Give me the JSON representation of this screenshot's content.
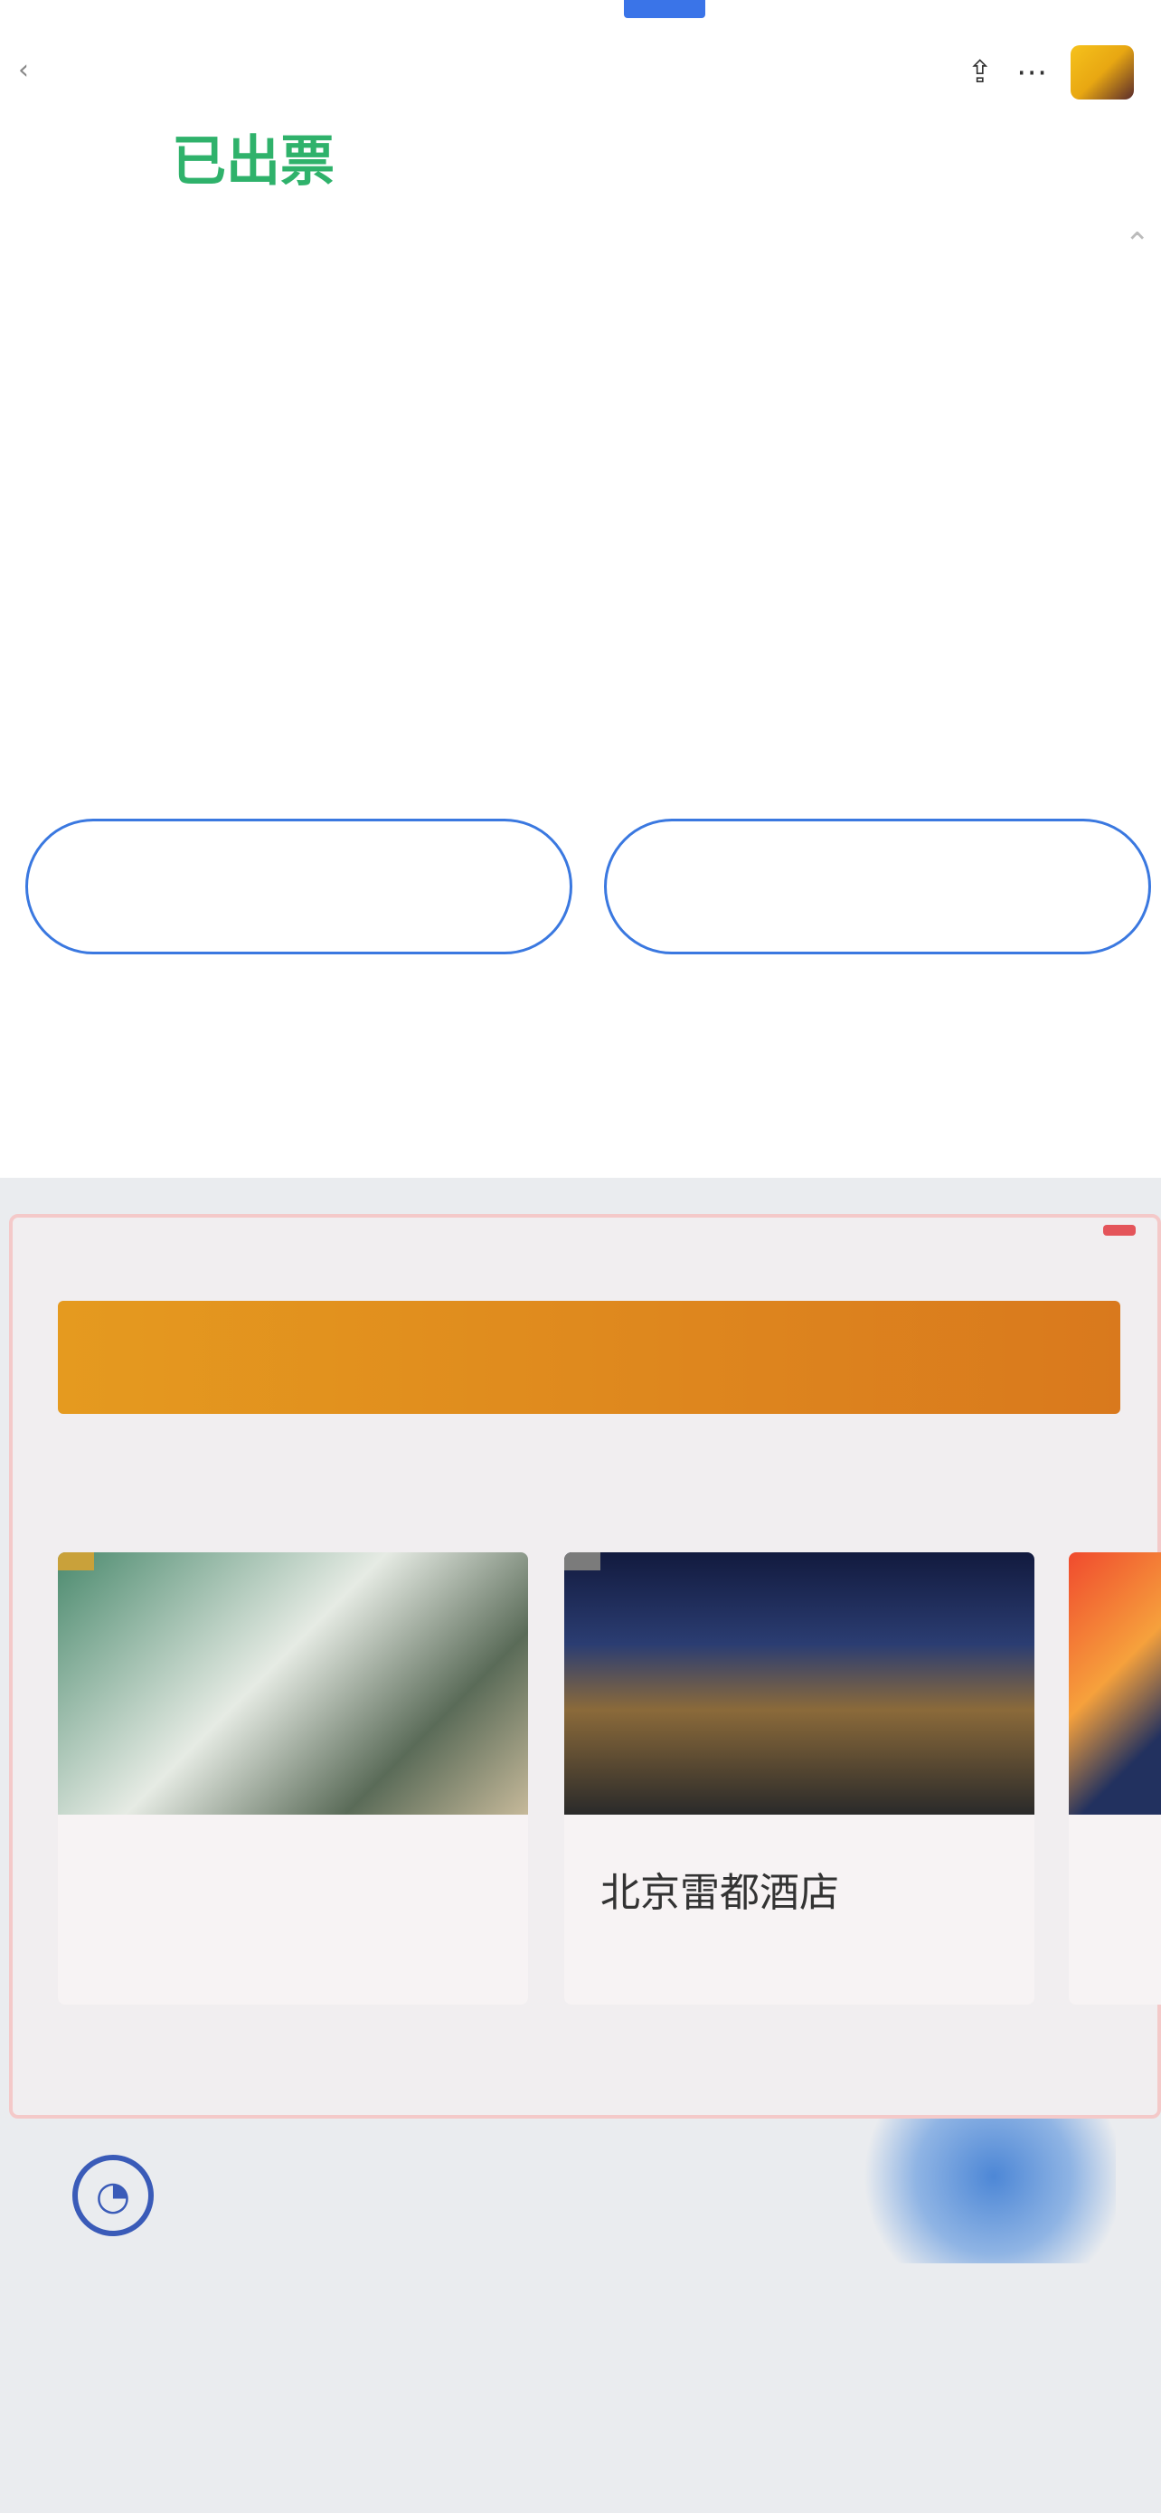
{
  "status_bar": {
    "time": ""
  },
  "order_status": {
    "text": "已出票",
    "subtitle": ""
  },
  "details": {
    "time": {
      "label": "",
      "line1": "",
      "line2_date": "",
      "line2_station": ""
    },
    "seat": {
      "label": "",
      "value": ""
    },
    "service": {
      "label": "",
      "line1": "",
      "line2": ""
    }
  },
  "actions": {
    "left_label": "",
    "right_label": ""
  },
  "notice_text": "",
  "promo": {
    "ad_tag": "",
    "banner_title": "",
    "section_title": "",
    "cards": [
      {
        "badge": "",
        "name": "",
        "price": ""
      },
      {
        "badge": "",
        "name": "北京雷都酒店",
        "price": ""
      },
      {
        "badge": "",
        "name": "",
        "price": ""
      }
    ],
    "service_title": "",
    "service_subtitle": "",
    "bottom_cells": [
      {
        "title": "",
        "subtitle": ""
      },
      {
        "title": "",
        "subtitle": ""
      }
    ]
  }
}
